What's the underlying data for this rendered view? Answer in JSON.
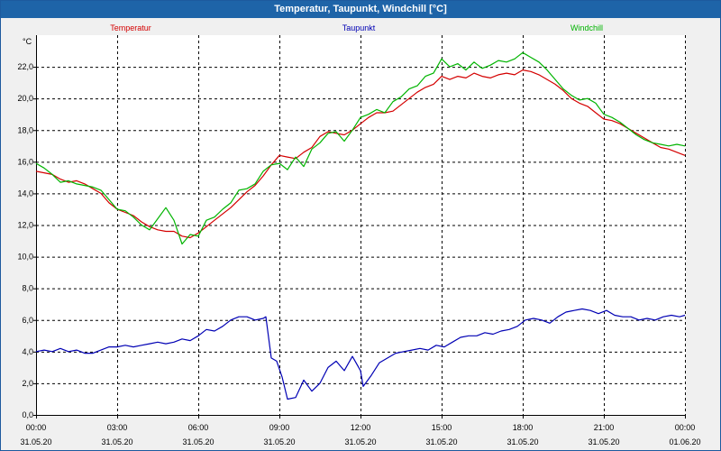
{
  "window": {
    "title": "Temperatur, Taupunkt, Windchill [°C]"
  },
  "chart_data": {
    "type": "line",
    "title": "Temperatur, Taupunkt, Windchill [°C]",
    "ylabel": "°C",
    "xlabel": "",
    "ylim": [
      0,
      24
    ],
    "xlim": [
      0,
      24
    ],
    "y_ticks": [
      {
        "value": 0,
        "label": "0,0"
      },
      {
        "value": 2,
        "label": "2,0"
      },
      {
        "value": 4,
        "label": "4,0"
      },
      {
        "value": 6,
        "label": "6,0"
      },
      {
        "value": 8,
        "label": "8,0"
      },
      {
        "value": 10,
        "label": "10,0"
      },
      {
        "value": 12,
        "label": "12,0"
      },
      {
        "value": 14,
        "label": "14,0"
      },
      {
        "value": 16,
        "label": "16,0"
      },
      {
        "value": 18,
        "label": "18,0"
      },
      {
        "value": 20,
        "label": "20,0"
      },
      {
        "value": 22,
        "label": "22,0"
      }
    ],
    "x_ticks": [
      {
        "value": 0,
        "time": "00:00",
        "date": "31.05.20"
      },
      {
        "value": 3,
        "time": "03:00",
        "date": "31.05.20"
      },
      {
        "value": 6,
        "time": "06:00",
        "date": "31.05.20"
      },
      {
        "value": 9,
        "time": "09:00",
        "date": "31.05.20"
      },
      {
        "value": 12,
        "time": "12:00",
        "date": "31.05.20"
      },
      {
        "value": 15,
        "time": "15:00",
        "date": "31.05.20"
      },
      {
        "value": 18,
        "time": "18:00",
        "date": "31.05.20"
      },
      {
        "value": 21,
        "time": "21:00",
        "date": "31.05.20"
      },
      {
        "value": 24,
        "time": "00:00",
        "date": "01.06.20"
      }
    ],
    "grid": true,
    "legend_position": "top",
    "series": [
      {
        "name": "Temperatur",
        "color": "#d40000",
        "points": [
          [
            0,
            15.4
          ],
          [
            0.3,
            15.3
          ],
          [
            0.6,
            15.2
          ],
          [
            0.9,
            14.9
          ],
          [
            1.2,
            14.7
          ],
          [
            1.5,
            14.8
          ],
          [
            1.8,
            14.6
          ],
          [
            2.1,
            14.3
          ],
          [
            2.4,
            14.0
          ],
          [
            2.7,
            13.4
          ],
          [
            3.0,
            13.0
          ],
          [
            3.3,
            12.8
          ],
          [
            3.6,
            12.6
          ],
          [
            3.9,
            12.2
          ],
          [
            4.2,
            11.9
          ],
          [
            4.5,
            11.7
          ],
          [
            4.8,
            11.6
          ],
          [
            5.1,
            11.6
          ],
          [
            5.4,
            11.3
          ],
          [
            5.7,
            11.2
          ],
          [
            6.0,
            11.5
          ],
          [
            6.3,
            11.9
          ],
          [
            6.6,
            12.3
          ],
          [
            6.9,
            12.7
          ],
          [
            7.2,
            13.1
          ],
          [
            7.5,
            13.6
          ],
          [
            7.8,
            14.1
          ],
          [
            8.1,
            14.5
          ],
          [
            8.4,
            15.1
          ],
          [
            8.7,
            15.8
          ],
          [
            9.0,
            16.4
          ],
          [
            9.3,
            16.3
          ],
          [
            9.6,
            16.2
          ],
          [
            9.9,
            16.6
          ],
          [
            10.2,
            16.9
          ],
          [
            10.5,
            17.6
          ],
          [
            10.8,
            17.9
          ],
          [
            11.1,
            17.8
          ],
          [
            11.4,
            17.7
          ],
          [
            11.7,
            18.0
          ],
          [
            12.0,
            18.4
          ],
          [
            12.3,
            18.8
          ],
          [
            12.6,
            19.1
          ],
          [
            12.9,
            19.1
          ],
          [
            13.2,
            19.2
          ],
          [
            13.5,
            19.6
          ],
          [
            13.8,
            20.0
          ],
          [
            14.1,
            20.4
          ],
          [
            14.4,
            20.7
          ],
          [
            14.7,
            20.9
          ],
          [
            15.0,
            21.4
          ],
          [
            15.3,
            21.2
          ],
          [
            15.6,
            21.4
          ],
          [
            15.9,
            21.3
          ],
          [
            16.2,
            21.6
          ],
          [
            16.5,
            21.4
          ],
          [
            16.8,
            21.3
          ],
          [
            17.1,
            21.5
          ],
          [
            17.4,
            21.6
          ],
          [
            17.7,
            21.5
          ],
          [
            18.0,
            21.8
          ],
          [
            18.3,
            21.7
          ],
          [
            18.6,
            21.5
          ],
          [
            18.9,
            21.2
          ],
          [
            19.2,
            20.9
          ],
          [
            19.5,
            20.5
          ],
          [
            19.8,
            20.0
          ],
          [
            20.1,
            19.7
          ],
          [
            20.4,
            19.5
          ],
          [
            20.7,
            19.1
          ],
          [
            21.0,
            18.7
          ],
          [
            21.3,
            18.6
          ],
          [
            21.6,
            18.4
          ],
          [
            21.9,
            18.1
          ],
          [
            22.2,
            17.8
          ],
          [
            22.5,
            17.5
          ],
          [
            22.8,
            17.2
          ],
          [
            23.1,
            16.9
          ],
          [
            23.4,
            16.8
          ],
          [
            23.7,
            16.6
          ],
          [
            24.0,
            16.4
          ]
        ]
      },
      {
        "name": "Taupunkt",
        "color": "#0000b4",
        "points": [
          [
            0,
            4.0
          ],
          [
            0.3,
            4.1
          ],
          [
            0.6,
            4.0
          ],
          [
            0.9,
            4.2
          ],
          [
            1.2,
            4.0
          ],
          [
            1.5,
            4.1
          ],
          [
            1.8,
            3.9
          ],
          [
            2.1,
            3.9
          ],
          [
            2.4,
            4.1
          ],
          [
            2.7,
            4.3
          ],
          [
            3.0,
            4.3
          ],
          [
            3.3,
            4.4
          ],
          [
            3.6,
            4.3
          ],
          [
            3.9,
            4.4
          ],
          [
            4.2,
            4.5
          ],
          [
            4.5,
            4.6
          ],
          [
            4.8,
            4.5
          ],
          [
            5.1,
            4.6
          ],
          [
            5.4,
            4.8
          ],
          [
            5.7,
            4.7
          ],
          [
            6.0,
            5.0
          ],
          [
            6.3,
            5.4
          ],
          [
            6.6,
            5.3
          ],
          [
            6.9,
            5.6
          ],
          [
            7.2,
            6.0
          ],
          [
            7.5,
            6.2
          ],
          [
            7.8,
            6.2
          ],
          [
            8.1,
            6.0
          ],
          [
            8.4,
            6.1
          ],
          [
            8.5,
            6.2
          ],
          [
            8.7,
            3.6
          ],
          [
            8.9,
            3.4
          ],
          [
            9.1,
            2.4
          ],
          [
            9.3,
            1.0
          ],
          [
            9.6,
            1.1
          ],
          [
            9.9,
            2.2
          ],
          [
            10.2,
            1.5
          ],
          [
            10.5,
            2.0
          ],
          [
            10.8,
            3.0
          ],
          [
            11.1,
            3.4
          ],
          [
            11.4,
            2.8
          ],
          [
            11.7,
            3.7
          ],
          [
            12.0,
            2.8
          ],
          [
            12.1,
            1.8
          ],
          [
            12.4,
            2.5
          ],
          [
            12.7,
            3.3
          ],
          [
            13.0,
            3.6
          ],
          [
            13.3,
            3.9
          ],
          [
            13.6,
            4.0
          ],
          [
            13.9,
            4.1
          ],
          [
            14.2,
            4.2
          ],
          [
            14.5,
            4.1
          ],
          [
            14.8,
            4.4
          ],
          [
            15.1,
            4.3
          ],
          [
            15.4,
            4.6
          ],
          [
            15.7,
            4.9
          ],
          [
            16.0,
            5.0
          ],
          [
            16.3,
            5.0
          ],
          [
            16.6,
            5.2
          ],
          [
            16.9,
            5.1
          ],
          [
            17.2,
            5.3
          ],
          [
            17.5,
            5.4
          ],
          [
            17.8,
            5.6
          ],
          [
            18.1,
            6.0
          ],
          [
            18.4,
            6.1
          ],
          [
            18.7,
            6.0
          ],
          [
            19.0,
            5.8
          ],
          [
            19.3,
            6.2
          ],
          [
            19.6,
            6.5
          ],
          [
            19.9,
            6.6
          ],
          [
            20.2,
            6.7
          ],
          [
            20.5,
            6.6
          ],
          [
            20.8,
            6.4
          ],
          [
            21.1,
            6.6
          ],
          [
            21.4,
            6.3
          ],
          [
            21.7,
            6.2
          ],
          [
            22.0,
            6.2
          ],
          [
            22.3,
            6.0
          ],
          [
            22.6,
            6.1
          ],
          [
            22.9,
            6.0
          ],
          [
            23.2,
            6.2
          ],
          [
            23.5,
            6.3
          ],
          [
            23.8,
            6.2
          ],
          [
            24.0,
            6.3
          ]
        ]
      },
      {
        "name": "Windchill",
        "color": "#00b400",
        "points": [
          [
            0,
            15.9
          ],
          [
            0.3,
            15.6
          ],
          [
            0.6,
            15.2
          ],
          [
            0.9,
            14.7
          ],
          [
            1.2,
            14.8
          ],
          [
            1.5,
            14.6
          ],
          [
            1.8,
            14.5
          ],
          [
            2.1,
            14.4
          ],
          [
            2.4,
            14.2
          ],
          [
            2.7,
            13.6
          ],
          [
            3.0,
            13.0
          ],
          [
            3.3,
            12.9
          ],
          [
            3.6,
            12.5
          ],
          [
            3.9,
            12.0
          ],
          [
            4.2,
            11.7
          ],
          [
            4.5,
            12.4
          ],
          [
            4.8,
            13.1
          ],
          [
            5.1,
            12.3
          ],
          [
            5.4,
            10.8
          ],
          [
            5.7,
            11.4
          ],
          [
            6.0,
            11.3
          ],
          [
            6.3,
            12.3
          ],
          [
            6.6,
            12.5
          ],
          [
            6.9,
            13.0
          ],
          [
            7.2,
            13.4
          ],
          [
            7.5,
            14.2
          ],
          [
            7.8,
            14.3
          ],
          [
            8.1,
            14.6
          ],
          [
            8.4,
            15.4
          ],
          [
            8.7,
            15.8
          ],
          [
            9.0,
            15.9
          ],
          [
            9.3,
            15.5
          ],
          [
            9.6,
            16.3
          ],
          [
            9.9,
            15.7
          ],
          [
            10.2,
            16.8
          ],
          [
            10.5,
            17.2
          ],
          [
            10.8,
            17.8
          ],
          [
            11.1,
            17.9
          ],
          [
            11.4,
            17.3
          ],
          [
            11.7,
            18.0
          ],
          [
            12.0,
            18.8
          ],
          [
            12.3,
            19.0
          ],
          [
            12.6,
            19.3
          ],
          [
            12.9,
            19.1
          ],
          [
            13.2,
            19.8
          ],
          [
            13.5,
            20.1
          ],
          [
            13.8,
            20.6
          ],
          [
            14.1,
            20.8
          ],
          [
            14.4,
            21.4
          ],
          [
            14.7,
            21.6
          ],
          [
            15.0,
            22.5
          ],
          [
            15.3,
            22.0
          ],
          [
            15.6,
            22.2
          ],
          [
            15.9,
            21.8
          ],
          [
            16.2,
            22.3
          ],
          [
            16.5,
            21.9
          ],
          [
            16.8,
            22.1
          ],
          [
            17.1,
            22.4
          ],
          [
            17.4,
            22.3
          ],
          [
            17.7,
            22.5
          ],
          [
            18.0,
            22.9
          ],
          [
            18.3,
            22.6
          ],
          [
            18.6,
            22.3
          ],
          [
            18.9,
            21.8
          ],
          [
            19.2,
            21.2
          ],
          [
            19.5,
            20.6
          ],
          [
            19.8,
            20.2
          ],
          [
            20.1,
            19.9
          ],
          [
            20.4,
            20.0
          ],
          [
            20.7,
            19.7
          ],
          [
            21.0,
            19.0
          ],
          [
            21.3,
            18.8
          ],
          [
            21.6,
            18.5
          ],
          [
            21.9,
            18.1
          ],
          [
            22.2,
            17.7
          ],
          [
            22.5,
            17.4
          ],
          [
            22.8,
            17.2
          ],
          [
            23.1,
            17.1
          ],
          [
            23.4,
            17.0
          ],
          [
            23.7,
            17.1
          ],
          [
            24.0,
            17.0
          ]
        ]
      }
    ]
  }
}
